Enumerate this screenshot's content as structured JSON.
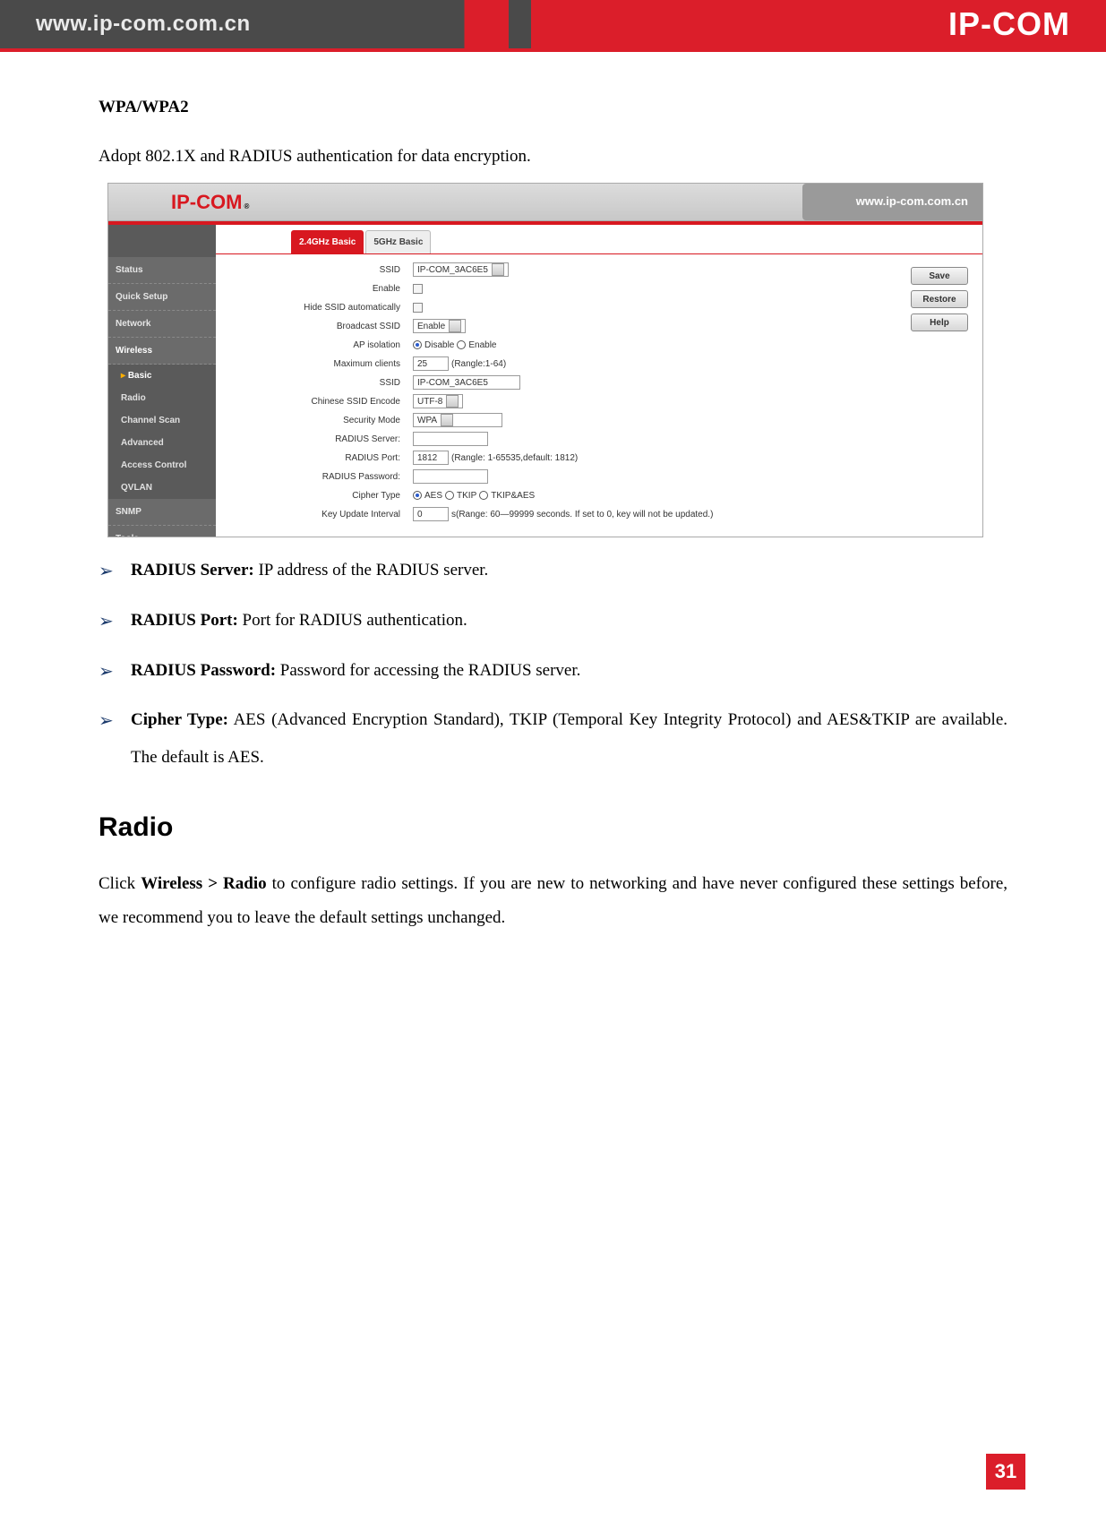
{
  "banner": {
    "url": "www.ip-com.com.cn",
    "logo": "IP-COM"
  },
  "doc": {
    "heading_wpa": "WPA/WPA2",
    "wpa_desc": "Adopt 802.1X and RADIUS authentication for data encryption.",
    "bullets": {
      "radius_server_label": "RADIUS Server:",
      "radius_server_text": " IP address of the RADIUS server.",
      "radius_port_label": "RADIUS Port:",
      "radius_port_text": " Port for RADIUS authentication.",
      "radius_password_label": "RADIUS Password:",
      "radius_password_text": " Password for accessing the RADIUS server.",
      "cipher_type_label": "Cipher Type:",
      "cipher_type_text": " AES (Advanced Encryption Standard), TKIP (Temporal Key Integrity Protocol) and AES&TKIP are available. The default is AES."
    },
    "heading_radio": "Radio",
    "radio_text_pre": "Click ",
    "radio_text_bold": "Wireless > Radio",
    "radio_text_post": " to configure radio settings. If you are new to networking and have never configured these settings before, we recommend you to leave the default settings unchanged."
  },
  "shot": {
    "logo": "IP-COM",
    "logo_sub": "®",
    "url": "www.ip-com.com.cn",
    "nav": {
      "status": "Status",
      "quick_setup": "Quick Setup",
      "network": "Network",
      "wireless": "Wireless",
      "basic": "Basic",
      "radio": "Radio",
      "channel_scan": "Channel Scan",
      "advanced": "Advanced",
      "access_control": "Access Control",
      "qvlan": "QVLAN",
      "snmp": "SNMP",
      "tools": "Tools"
    },
    "tabs": {
      "t1": "2.4GHz Basic",
      "t2": "5GHz Basic"
    },
    "form": {
      "ssid_sel_label": "SSID",
      "ssid_sel_value": "IP-COM_3AC6E5",
      "enable_label": "Enable",
      "hide_ssid_label": "Hide SSID automatically",
      "broadcast_label": "Broadcast SSID",
      "broadcast_value": "Enable",
      "ap_isolation_label": "AP isolation",
      "ap_disable": "Disable",
      "ap_enable": "Enable",
      "max_clients_label": "Maximum clients",
      "max_clients_value": "25",
      "max_clients_hint": "(Rangle:1-64)",
      "ssid_text_label": "SSID",
      "ssid_text_value": "IP-COM_3AC6E5",
      "encode_label": "Chinese SSID Encode",
      "encode_value": "UTF-8",
      "sec_mode_label": "Security Mode",
      "sec_mode_value": "WPA",
      "radius_server_label": "RADIUS Server:",
      "radius_server_value": "",
      "radius_port_label": "RADIUS Port:",
      "radius_port_value": "1812",
      "radius_port_hint": "(Rangle: 1-65535,default: 1812)",
      "radius_password_label": "RADIUS Password:",
      "radius_password_value": "",
      "cipher_type_label": "Cipher Type",
      "cipher_aes": "AES",
      "cipher_tkip": "TKIP",
      "cipher_both": "TKIP&AES",
      "key_update_label": "Key Update Interval",
      "key_update_value": "0",
      "key_update_hint": "s(Range: 60—99999 seconds. If set to 0, key will not be updated.)"
    },
    "buttons": {
      "save": "Save",
      "restore": "Restore",
      "help": "Help"
    }
  },
  "page_number": "31"
}
